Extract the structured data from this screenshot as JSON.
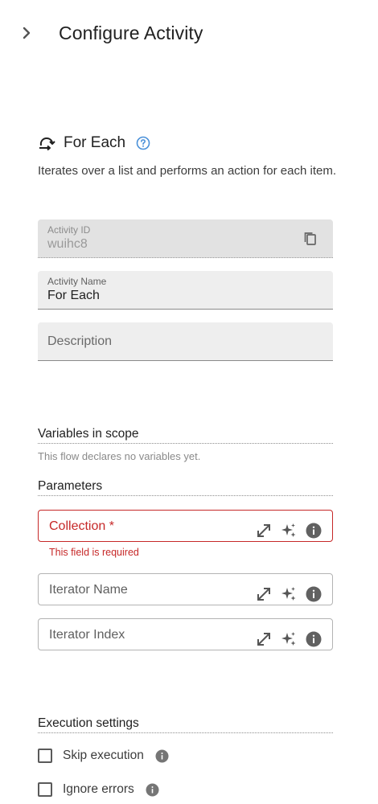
{
  "header": {
    "title": "Configure Activity",
    "back_icon": "chevron-right-icon"
  },
  "activity": {
    "type_label": "For Each",
    "icon": "loop-arrow-icon",
    "help_icon": "help-circle-icon",
    "description": "Iterates over a list and performs an action for each item."
  },
  "fields": {
    "activity_id": {
      "label": "Activity ID",
      "value": "wuihc8",
      "icon": "copy-icon"
    },
    "activity_name": {
      "label": "Activity Name",
      "value": "For Each"
    },
    "description": {
      "placeholder": "Description"
    }
  },
  "variables": {
    "title": "Variables in scope",
    "empty_text": "This flow declares no variables yet."
  },
  "parameters": {
    "title": "Parameters",
    "items": [
      {
        "label": "Collection *",
        "required": true,
        "error": "This field is required"
      },
      {
        "label": "Iterator Name",
        "required": false
      },
      {
        "label": "Iterator Index",
        "required": false
      }
    ],
    "icons": [
      "expand-icon",
      "sparkle-icon",
      "info-icon"
    ]
  },
  "execution": {
    "title": "Execution settings",
    "options": [
      {
        "label": "Skip execution",
        "checked": false
      },
      {
        "label": "Ignore errors",
        "checked": false
      }
    ]
  },
  "colors": {
    "error": "#c62828",
    "help": "#1976d2",
    "field_bg": "#eeeeee"
  }
}
